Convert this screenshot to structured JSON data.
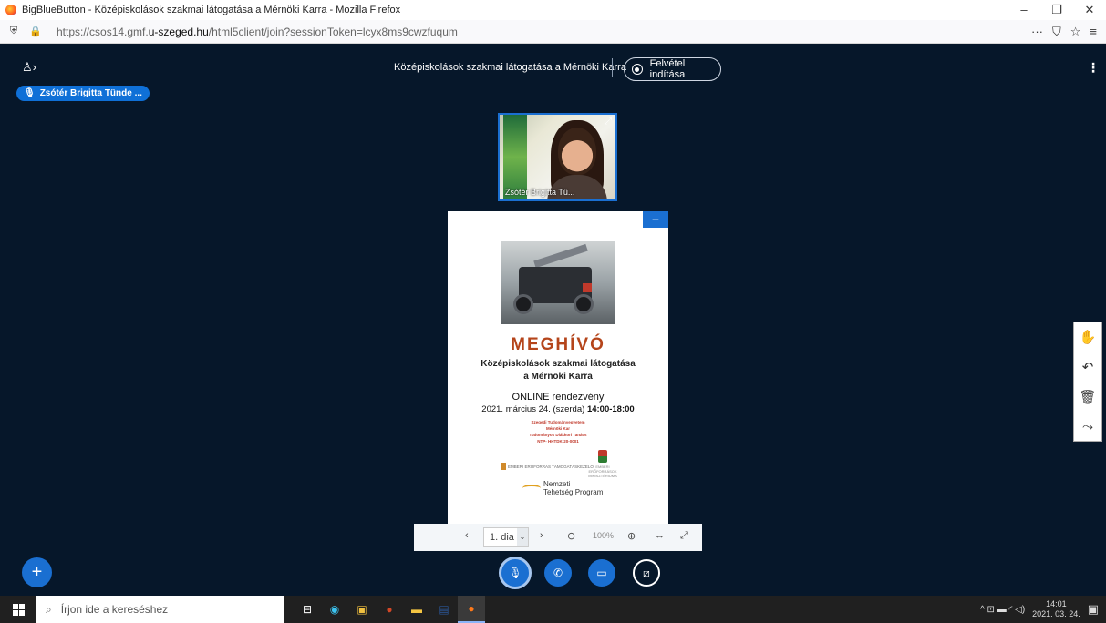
{
  "window": {
    "title": "BigBlueButton - Középiskolások szakmai látogatása a Mérnöki Karra - Mozilla Firefox",
    "minimize": "–",
    "restore": "❐",
    "close": "✕"
  },
  "urlbar": {
    "url_prefix": "https://csos14.gmf.",
    "url_domain": "u-szeged.hu",
    "url_suffix": "/html5client/join?sessionToken=lcyx8ms9cwzfuqum",
    "menu_dots": "···",
    "pocket": "⛉",
    "star": "☆",
    "hamburger": "≡"
  },
  "app": {
    "users_toggle": "♙›",
    "meeting_title": "Középiskolások szakmai látogatása a Mérnöki Karra",
    "record_label": "Felvétel indítása",
    "options": "⋮",
    "talker_name": "Zsótér Brigitta Tünde ...",
    "webcam_name": "Zsótér Brigitta Tü...",
    "expand_icon": "⤢",
    "minimize_presentation": "–"
  },
  "slide": {
    "headline": "MEGHÍVÓ",
    "sub1": "Középiskolások szakmai látogatása",
    "sub2": "a Mérnöki Karra",
    "event": "ONLINE rendezvény",
    "date_text": "2021. március 24. (szerda) ",
    "date_time": "14:00-18:00",
    "org1": "Szegedi Tudományegyetem",
    "org2": "Mérnöki Kar",
    "org3": "Tudományos Diákköri Tanács",
    "org4": "NTP- HHTDK-20-0001",
    "logo_left": "EMBERI ERŐFORRÁS TÁMOGATÁSKEZELŐ",
    "logo_right": "EMBERI ERŐFORRÁSOK MINISZTÉRIUMA",
    "logo_ntp_top": "Nemzeti",
    "logo_ntp_bottom": "Tehetség Program"
  },
  "presentation_toolbar": {
    "prev": "‹",
    "slide_label": "1. dia",
    "caret": "⌄",
    "next": "›",
    "zoom_out": "⊖",
    "zoom_level": "100%",
    "zoom_in": "⊕",
    "fit_width": "↔",
    "fullscreen": "⤢"
  },
  "side_tools": {
    "hand": "✋",
    "undo": "↶",
    "trash": "🗑",
    "chart": "⤳"
  },
  "controls": {
    "plus": "+",
    "mic": "🎙",
    "phone": "✆",
    "camera": "▭",
    "share": "⧄"
  },
  "taskbar": {
    "search_placeholder": "Írjon ide a kereséshez",
    "search_icon": "⌕",
    "task_view": "⊟",
    "time": "14:01",
    "date": "2021. 03. 24.",
    "tray_icons": "^  ⊡  ▬  ◜  ◁)",
    "notification": "▣"
  }
}
